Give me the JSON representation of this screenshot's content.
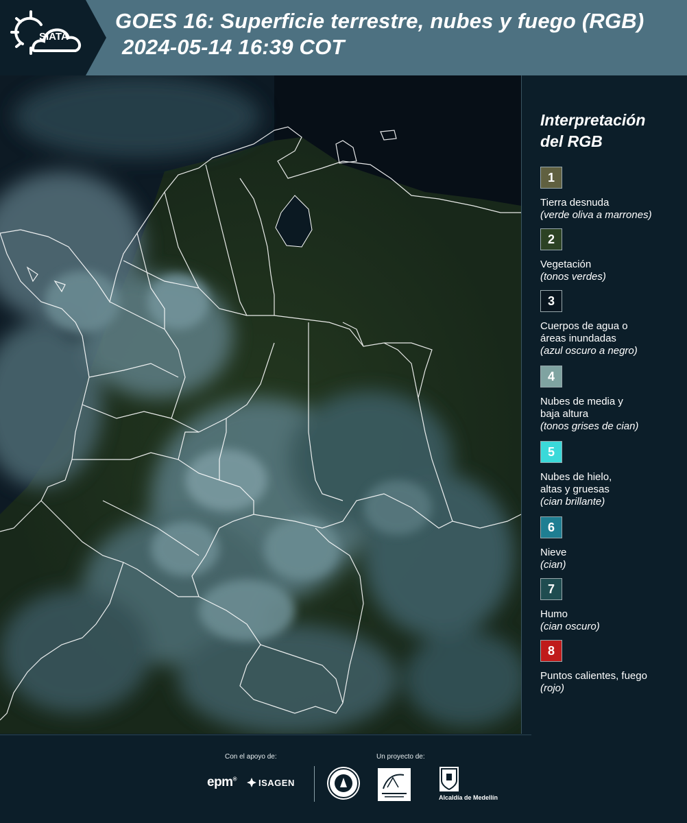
{
  "header": {
    "logo_text": "SIATA",
    "title_line1": "GOES 16: Superficie terrestre, nubes y fuego (RGB)",
    "title_line2": "2024-05-14 16:39 COT"
  },
  "legend": {
    "title_line1": "Interpretación",
    "title_line2": "del RGB",
    "items": [
      {
        "number": "1",
        "label": "Tierra desnuda",
        "desc": "(verde oliva a marrones)",
        "color": "#606040"
      },
      {
        "number": "2",
        "label": "Vegetación",
        "desc": "(tonos verdes)",
        "color": "#2c4224"
      },
      {
        "number": "3",
        "label": "Cuerpos de agua o\náreas inundadas",
        "desc": "(azul oscuro a negro)",
        "color": "#0a1620"
      },
      {
        "number": "4",
        "label": "Nubes de media y\nbaja altura",
        "desc": "(tonos grises de cian)",
        "color": "#7fa3a1"
      },
      {
        "number": "5",
        "label": "Nubes de hielo,\naltas y gruesas",
        "desc": "(cian brillante)",
        "color": "#3ad9d9"
      },
      {
        "number": "6",
        "label": "Nieve",
        "desc": "(cian)",
        "color": "#1e7e92"
      },
      {
        "number": "7",
        "label": "Humo",
        "desc": "(cian oscuro)",
        "color": "#1f4c50"
      },
      {
        "number": "8",
        "label": "Puntos calientes, fuego",
        "desc": "(rojo)",
        "color": "#c01b1b"
      }
    ]
  },
  "footer": {
    "support_label": "Con el apoyo de:",
    "project_label": "Un proyecto de:",
    "epm_text": "epm",
    "isagen_text": "ISAGEN",
    "alcaldia_text": "Alcaldía de Medellín"
  }
}
